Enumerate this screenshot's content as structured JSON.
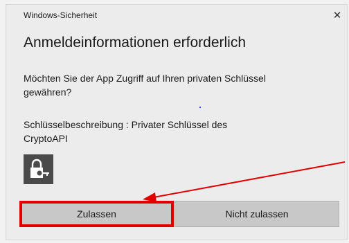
{
  "window": {
    "title": "Windows-Sicherheit",
    "heading": "Anmeldeinformationen erforderlich",
    "prompt": "Möchten Sie der App Zugriff auf Ihren privaten Schlüssel gewähren?",
    "description": "Schlüsselbeschreibung  : Privater Schlüssel des CryptoAPI",
    "close_icon": "close-icon",
    "key_icon": "lock-key-icon"
  },
  "buttons": {
    "allow_label": "Zulassen",
    "deny_label": "Nicht zulassen"
  },
  "annotation": {
    "highlight_color": "#e00000",
    "arrow_color": "#e00000",
    "highlighted_button": "Zulassen"
  }
}
